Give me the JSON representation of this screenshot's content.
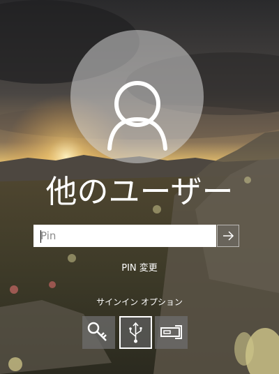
{
  "user": {
    "name": "他のユーザー",
    "avatar_icon": "person-icon"
  },
  "pin": {
    "placeholder": "Pin",
    "value": ""
  },
  "submit": {
    "icon": "arrow-right-icon"
  },
  "change_pin_label": "PIN 変更",
  "signin_options": {
    "label": "サインイン オプション",
    "items": [
      {
        "icon": "key-icon",
        "selected": false
      },
      {
        "icon": "usb-icon",
        "selected": true
      },
      {
        "icon": "smart-card-icon",
        "selected": false
      }
    ]
  }
}
